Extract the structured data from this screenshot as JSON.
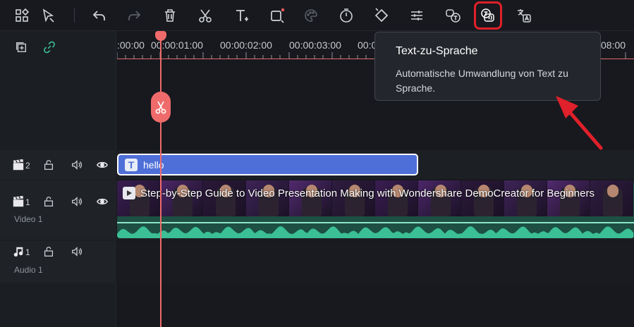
{
  "toolbar": {
    "icons": [
      "layout-icon",
      "select-tool-icon",
      "undo-icon",
      "redo-icon",
      "delete-icon",
      "split-icon",
      "text-icon",
      "crop-icon",
      "color-palette-icon",
      "speed-timer-icon",
      "transition-icon",
      "adjust-icon",
      "speech-to-text-icon",
      "text-to-speech-icon",
      "translate-icon"
    ]
  },
  "ruler": {
    "ticks": [
      ":00:00",
      "00:00:01:00",
      "00:00:02:00",
      "00:00:03:00",
      "00:00:04:",
      "08:00"
    ]
  },
  "tracks": {
    "text_track": {
      "number": "2"
    },
    "video_track": {
      "number": "1",
      "name": "Video 1"
    },
    "audio_track": {
      "number": "1",
      "name": "Audio 1"
    }
  },
  "clips": {
    "text_clip": {
      "badge": "T",
      "label": "hello",
      "color": "#4f6fd8"
    },
    "video_clip": {
      "title": "Step-by-Step Guide to Video Presentation Making with Wondershare DemoCreator for Beginners",
      "color": "#1d4f43"
    }
  },
  "tooltip": {
    "title": "Text-zu-Sprache",
    "body": "Automatische Umwandlung von Text zu Sprache."
  },
  "colors": {
    "playhead": "#ef6b6b",
    "highlight": "#e0202a",
    "waveform": "#3bbf95"
  }
}
